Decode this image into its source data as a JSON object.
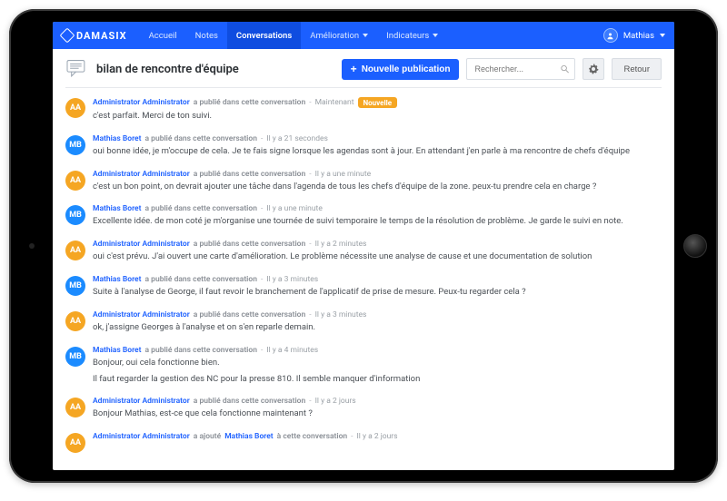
{
  "brand": "DAMASIX",
  "nav": {
    "items": [
      {
        "label": "Accueil",
        "active": false
      },
      {
        "label": "Notes",
        "active": false
      },
      {
        "label": "Conversations",
        "active": true
      },
      {
        "label": "Amélioration",
        "active": false,
        "caret": true
      },
      {
        "label": "Indicateurs",
        "active": false,
        "caret": true
      }
    ]
  },
  "user": {
    "name": "Mathias"
  },
  "header": {
    "title": "bilan de rencontre d'équipe",
    "new_publication": "Nouvelle publication",
    "search_placeholder": "Rechercher...",
    "back": "Retour"
  },
  "badges": {
    "new": "Nouvelle"
  },
  "actions": {
    "posted": "a publié dans cette conversation",
    "added": "a ajouté"
  },
  "authors": {
    "admin": {
      "name": "Administrator Administrator",
      "initials": "AA",
      "color": "aa"
    },
    "mathias": {
      "name": "Mathias Boret",
      "initials": "MB",
      "color": "mb"
    }
  },
  "messages": [
    {
      "author": "admin",
      "action_key": "posted",
      "time": "Maintenant",
      "badge": "new",
      "text": "c'est parfait. Merci de ton suivi."
    },
    {
      "author": "mathias",
      "action_key": "posted",
      "time": "Il y a 21 secondes",
      "text": "oui bonne idée, je m'occupe de cela. Je te fais signe lorsque les agendas sont à jour. En attendant j'en parle à ma rencontre de chefs d'équipe"
    },
    {
      "author": "admin",
      "action_key": "posted",
      "time": "Il y a une minute",
      "text": "c'est un bon point, on devrait ajouter une tâche dans l'agenda de tous les chefs d'équipe de la zone. peux-tu prendre cela en charge ?"
    },
    {
      "author": "mathias",
      "action_key": "posted",
      "time": "Il y a une minute",
      "text": "Excellente idée. de mon coté je m'organise une tournée de suivi temporaire le temps de la résolution de problème. Je garde le suivi en note."
    },
    {
      "author": "admin",
      "action_key": "posted",
      "time": "Il y a 2 minutes",
      "text": "oui c'est prévu. J'ai ouvert une carte d'amélioration. Le problème nécessite une analyse de cause et une documentation de solution"
    },
    {
      "author": "mathias",
      "action_key": "posted",
      "time": "Il y a 3 minutes",
      "text": "Suite à l'analyse de George, il faut revoir le branchement de l'applicatif de prise de mesure. Peux-tu regarder cela ?"
    },
    {
      "author": "admin",
      "action_key": "posted",
      "time": "Il y a 3 minutes",
      "text": "ok, j'assigne Georges à l'analyse et on s'en reparle demain."
    },
    {
      "author": "mathias",
      "action_key": "posted",
      "time": "Il y a 4 minutes",
      "text": "Bonjour, oui cela fonctionne bien.",
      "text2": "Il faut regarder la gestion des NC pour la presse 810. Il semble manquer d'information"
    },
    {
      "author": "admin",
      "action_key": "posted",
      "time": "Il y a 2 jours",
      "text": "Bonjour Mathias, est-ce que cela fonctionne maintenant ?"
    },
    {
      "author": "admin",
      "action_key": "added",
      "target_author": "mathias",
      "action_suffix": "à cette conversation",
      "time": "Il y a 2 jours"
    }
  ]
}
